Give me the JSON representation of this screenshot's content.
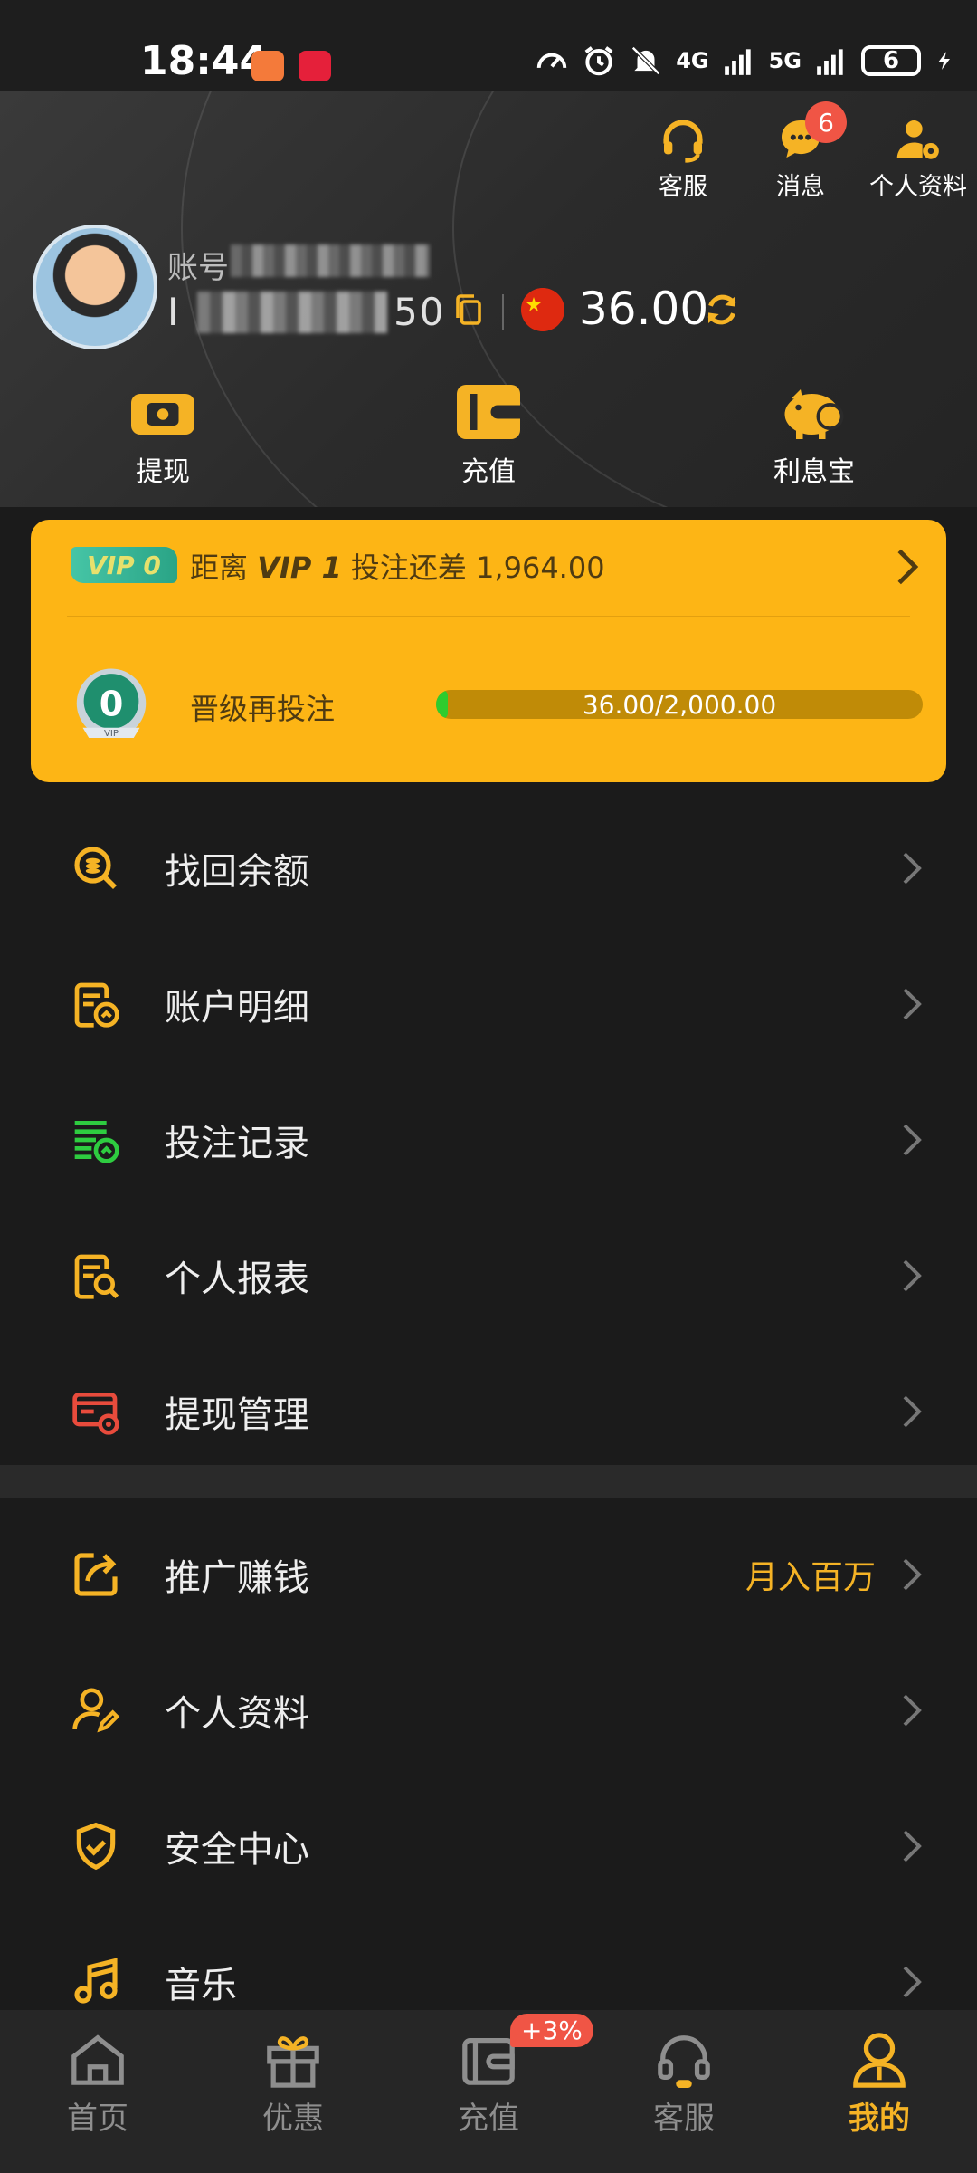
{
  "status_bar": {
    "time": "18:44",
    "network_4g": "4G",
    "network_5g": "5G",
    "battery": "6"
  },
  "header": {
    "actions": [
      {
        "label": "客服",
        "icon": "headset-icon"
      },
      {
        "label": "消息",
        "icon": "chat-icon",
        "badge": "6"
      },
      {
        "label": "个人资料",
        "icon": "profile-settings-icon"
      }
    ],
    "account_label": "账号",
    "account_id_prefix": "I",
    "account_id_suffix": "50",
    "balance": "36.00",
    "quick_actions": [
      {
        "label": "提现",
        "icon": "withdraw-icon"
      },
      {
        "label": "充值",
        "icon": "wallet-icon"
      },
      {
        "label": "利息宝",
        "icon": "piggy-bank-icon"
      }
    ]
  },
  "vip": {
    "tag": "VIP 0",
    "distance_prefix": "距离 ",
    "next_level": "VIP 1",
    "distance_suffix": " 投注还差 1,964.00",
    "medal_level": "0",
    "upgrade_label": "晋级再投注",
    "progress_text": "36.00/2,000.00",
    "progress_fraction": 0.018
  },
  "menu_group_1": [
    {
      "label": "找回余额",
      "icon": "search-coin-icon"
    },
    {
      "label": "账户明细",
      "icon": "account-details-icon"
    },
    {
      "label": "投注记录",
      "icon": "bet-record-icon"
    },
    {
      "label": "个人报表",
      "icon": "report-search-icon"
    },
    {
      "label": "提现管理",
      "icon": "withdraw-manage-icon"
    }
  ],
  "menu_group_2": [
    {
      "label": "推广赚钱",
      "icon": "share-icon",
      "right_text": "月入百万"
    },
    {
      "label": "个人资料",
      "icon": "user-edit-icon"
    },
    {
      "label": "安全中心",
      "icon": "shield-check-icon"
    },
    {
      "label": "音乐",
      "icon": "music-icon"
    }
  ],
  "bottom_nav": [
    {
      "label": "首页",
      "icon": "home-icon"
    },
    {
      "label": "优惠",
      "icon": "gift-icon"
    },
    {
      "label": "充值",
      "icon": "wallet-icon",
      "badge": "+3%"
    },
    {
      "label": "客服",
      "icon": "headset-icon"
    },
    {
      "label": "我的",
      "icon": "person-icon",
      "active": true
    }
  ],
  "colors": {
    "accent": "#f5b325",
    "vip_card": "#fdb515",
    "badge": "#f05545",
    "progress_fill": "#2ecc2e",
    "background": "#1b1b1b"
  }
}
